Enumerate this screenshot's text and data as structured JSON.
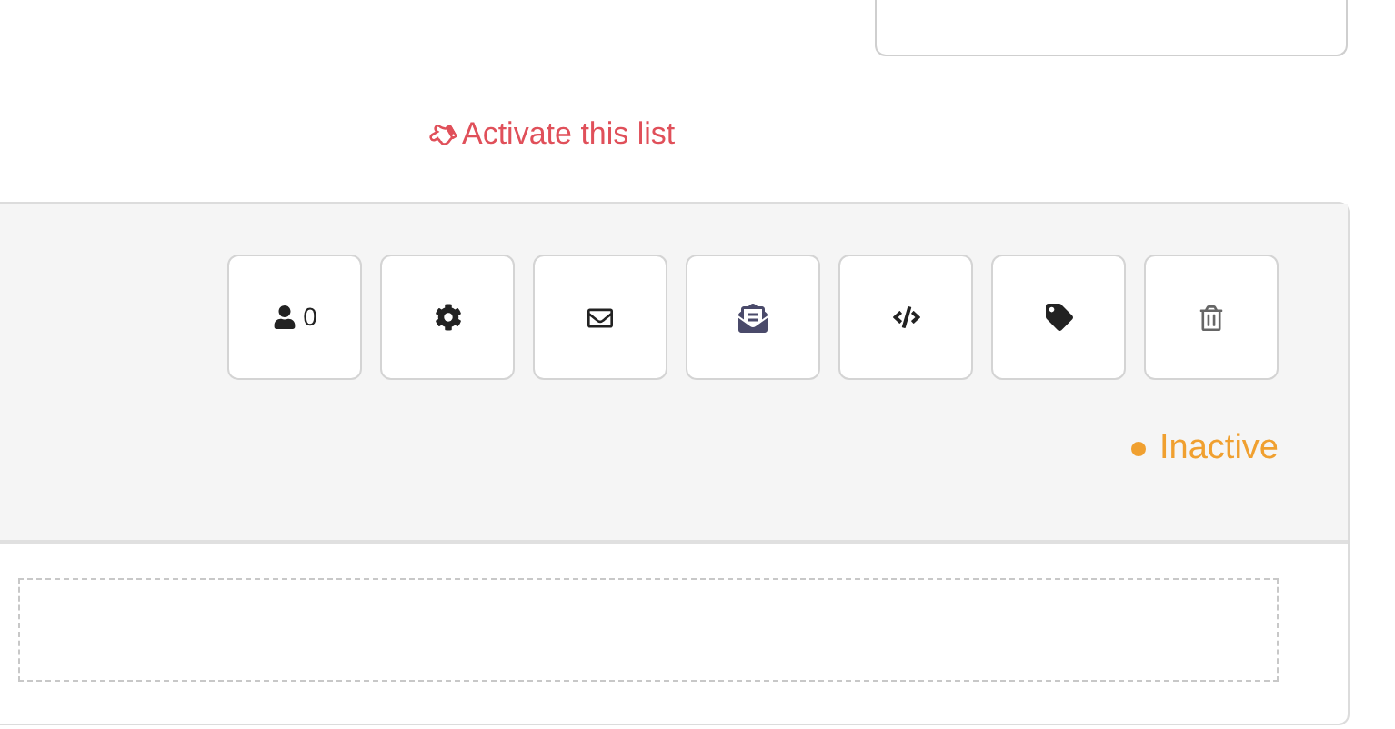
{
  "activate_link": {
    "label": "Activate this list"
  },
  "buttons": [
    {
      "kind": "subscribers",
      "count": "0"
    },
    {
      "kind": "settings"
    },
    {
      "kind": "email"
    },
    {
      "kind": "emails"
    },
    {
      "kind": "code"
    },
    {
      "kind": "tag"
    },
    {
      "kind": "delete"
    }
  ],
  "status": {
    "label": "Inactive",
    "color": "#f0a030"
  }
}
